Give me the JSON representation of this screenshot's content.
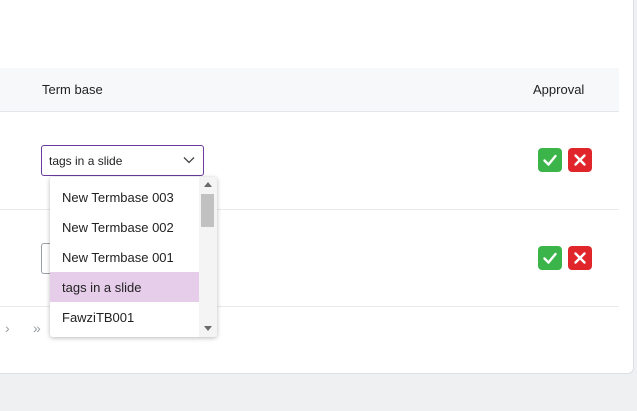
{
  "table": {
    "headers": {
      "term_base": "Term base",
      "approval": "Approval"
    },
    "rows": [
      {
        "term_base_value": "tags in a slide"
      },
      {
        "term_base_value": ""
      }
    ]
  },
  "dropdown": {
    "options": [
      {
        "label": "New Termbase 003",
        "selected": false
      },
      {
        "label": "New Termbase 002",
        "selected": false
      },
      {
        "label": "New Termbase 001",
        "selected": false
      },
      {
        "label": "tags in a slide",
        "selected": true
      },
      {
        "label": "FawziTB001",
        "selected": false
      }
    ]
  },
  "pager": {
    "next": "›",
    "last": "»"
  },
  "icons": {
    "approve": "check-icon",
    "reject": "close-icon",
    "select_arrow": "chevron-down-icon"
  },
  "colors": {
    "accent": "#6a3a9c",
    "selected_option": "#e6cdea",
    "approve": "#3bb54a",
    "reject": "#e0262b"
  }
}
